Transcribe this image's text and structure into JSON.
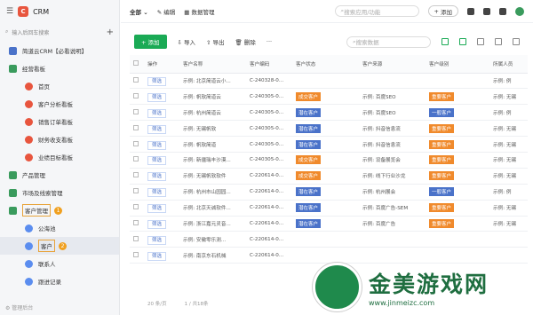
{
  "app": {
    "name": "CRM",
    "logo_letter": "C"
  },
  "sidebar": {
    "search_placeholder": "输入后回车搜索",
    "items": [
      {
        "label": "简道云CRM【必看说明】",
        "level": 0,
        "icon": "doc-icon"
      },
      {
        "label": "经营看板",
        "level": 0,
        "icon": "folder-icon"
      },
      {
        "label": "首页",
        "level": 1,
        "icon": "dashboard-icon"
      },
      {
        "label": "客户分析看板",
        "level": 1,
        "icon": "dashboard-icon"
      },
      {
        "label": "销售订单看板",
        "level": 1,
        "icon": "dashboard-icon"
      },
      {
        "label": "财务收支看板",
        "level": 1,
        "icon": "dashboard-icon"
      },
      {
        "label": "业绩目标看板",
        "level": 1,
        "icon": "dashboard-icon"
      },
      {
        "label": "产品管理",
        "level": 0,
        "icon": "folder-icon"
      },
      {
        "label": "市场及线索管理",
        "level": 0,
        "icon": "folder-icon"
      },
      {
        "label": "客户管理",
        "level": 0,
        "icon": "folder-icon",
        "badge": "1"
      },
      {
        "label": "公海池",
        "level": 1,
        "icon": "user-icon"
      },
      {
        "label": "客户",
        "level": 1,
        "icon": "user-icon",
        "badge": "2"
      },
      {
        "label": "联系人",
        "level": 1,
        "icon": "user-icon"
      },
      {
        "label": "跟进记录",
        "level": 1,
        "icon": "user-icon"
      }
    ],
    "bottom": "管理后台"
  },
  "topbar": {
    "scope": "全部",
    "edit": "编辑",
    "data_manage": "数据管理",
    "search_placeholder": "搜索应用/功能",
    "add": "添加"
  },
  "toolbar": {
    "add": "添加",
    "import": "导入",
    "export": "导出",
    "delete": "删除",
    "more": "···",
    "search_placeholder": "搜索数据"
  },
  "table": {
    "columns": [
      "操作",
      "客户名称",
      "客户编码",
      "客户状态",
      "客户来源",
      "客户级别",
      "所属人员"
    ],
    "view_label": "筛选",
    "rows": [
      {
        "name": "示例: 北京简道云小...",
        "code": "C-240328-0...",
        "status": "",
        "source": "",
        "level": "",
        "owner": "示例: 例"
      },
      {
        "name": "示例: 帆软简道云",
        "code": "C-240305-0...",
        "status": "成交客户",
        "source": "示例: 百度SEO",
        "level": "重要客户",
        "owner": "示例: 无锡"
      },
      {
        "name": "示例: 杭州简道云",
        "code": "C-240305-0...",
        "status": "潜在客户",
        "source": "示例: 百度SEO",
        "level": "一般客户",
        "owner": "示例: 例"
      },
      {
        "name": "示例: 无锡帆软",
        "code": "C-240305-0...",
        "status": "潜在客户",
        "source": "示例: 抖音信息流",
        "level": "重要客户",
        "owner": "示例: 无锡"
      },
      {
        "name": "示例: 帆软简道",
        "code": "C-240305-0...",
        "status": "潜在客户",
        "source": "示例: 抖音信息流",
        "level": "重要客户",
        "owner": "示例: 无锡"
      },
      {
        "name": "示例: 新疆瑞丰沙漠...",
        "code": "C-240305-0...",
        "status": "成交客户",
        "source": "示例: 设备展览会",
        "level": "重要客户",
        "owner": "示例: 无锡"
      },
      {
        "name": "示例: 无锡帆软软件",
        "code": "C-220614-0...",
        "status": "成交客户",
        "source": "示例: 线下行业沙龙",
        "level": "重要客户",
        "owner": "示例: 无锡"
      },
      {
        "name": "示例: 杭州市山园园...",
        "code": "C-220614-0...",
        "status": "潜在客户",
        "source": "示例: 杭州展会",
        "level": "一般客户",
        "owner": "示例: 例"
      },
      {
        "name": "示例: 北京天诚软件...",
        "code": "C-220614-0...",
        "status": "潜在客户",
        "source": "示例: 百度广告-SEM",
        "level": "重要客户",
        "owner": "示例: 无锡"
      },
      {
        "name": "示例: 浙江嘉元灵音...",
        "code": "C-220614-0...",
        "status": "潜在客户",
        "source": "示例: 百度广告",
        "level": "重要客户",
        "owner": "示例: 无锡"
      },
      {
        "name": "示例: 安徽零乐测...",
        "code": "C-220614-0...",
        "status": "",
        "source": "",
        "level": "",
        "owner": ""
      },
      {
        "name": "示例: 南京东石机械",
        "code": "C-220614-0...",
        "status": "",
        "source": "",
        "level": "",
        "owner": ""
      }
    ]
  },
  "footer": {
    "page_size": "20 条/页",
    "total": "1 / 共18条"
  },
  "watermark": {
    "text": "金美游戏网",
    "url": "www.jinmeizc.com"
  },
  "colors": {
    "accent": "#1aaa55",
    "status_orange": "#f08a2c",
    "status_blue": "#4a72c9"
  }
}
